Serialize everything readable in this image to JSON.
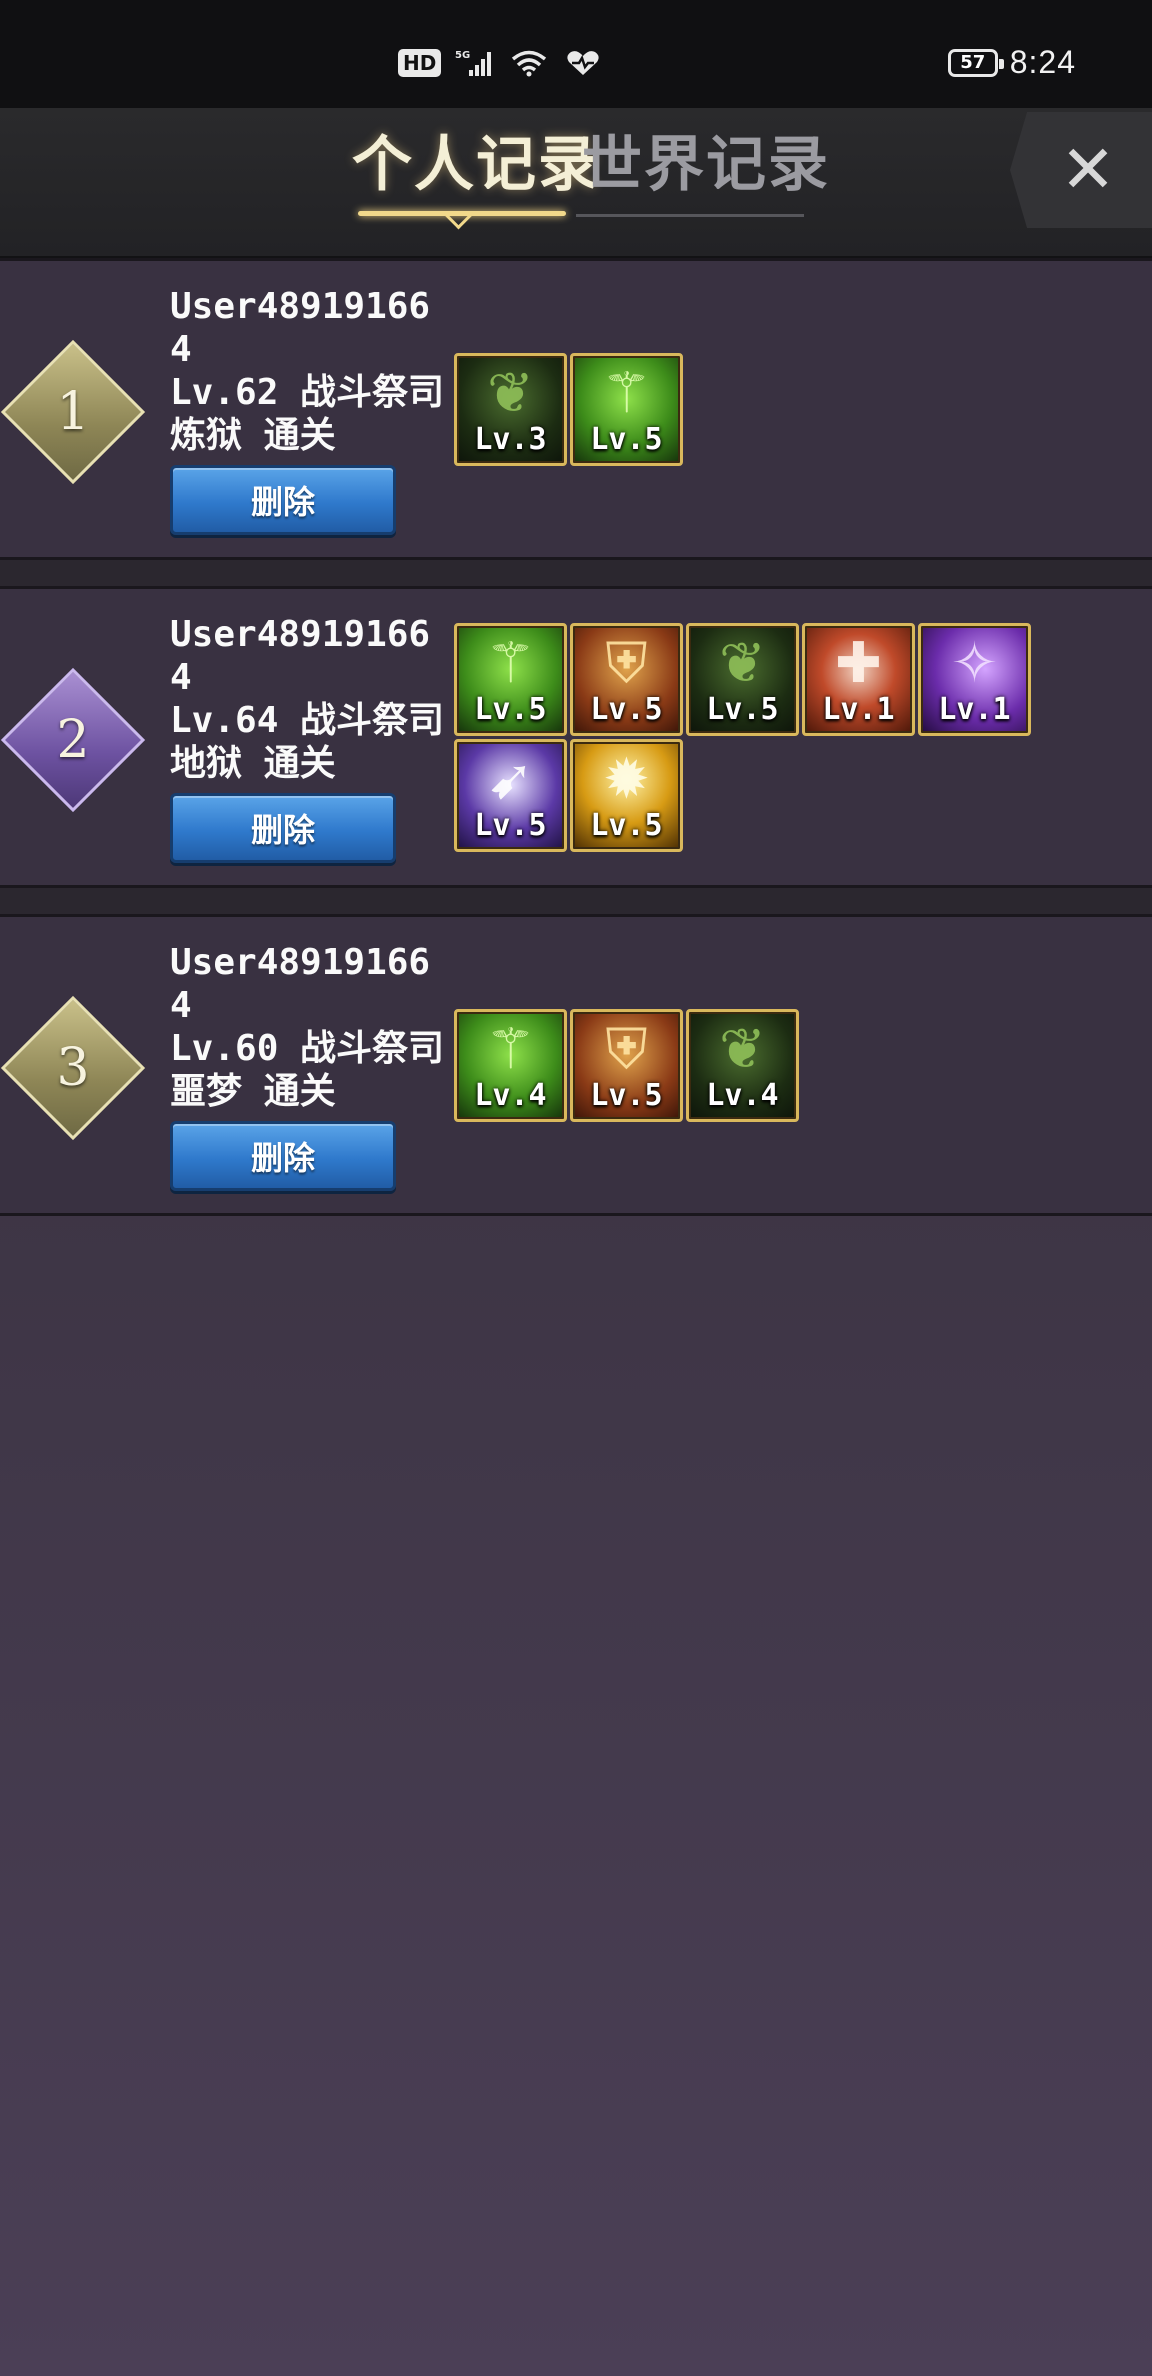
{
  "status_bar": {
    "hd": "HD",
    "network": "5G",
    "battery": "57",
    "time": "8:24"
  },
  "header": {
    "tabs": [
      {
        "label": "个人记录",
        "active": true
      },
      {
        "label": "世界记录",
        "active": false
      }
    ],
    "close": "✕"
  },
  "records": [
    {
      "rank": "1",
      "user": "User489191664",
      "level_class": "Lv.62 战斗祭司",
      "difficulty_result": "炼狱 通关",
      "delete_label": "删除",
      "skills": [
        {
          "icon": "vine-icon",
          "level": "Lv.3"
        },
        {
          "icon": "green-staff-icon",
          "level": "Lv.5"
        }
      ]
    },
    {
      "rank": "2",
      "user": "User489191664",
      "level_class": "Lv.64 战斗祭司",
      "difficulty_result": "地狱 通关",
      "delete_label": "删除",
      "skills": [
        {
          "icon": "green-staff-icon",
          "level": "Lv.5"
        },
        {
          "icon": "golden-shield-icon",
          "level": "Lv.5"
        },
        {
          "icon": "vine-icon",
          "level": "Lv.5"
        },
        {
          "icon": "holy-cross-icon",
          "level": "Lv.1"
        },
        {
          "icon": "purple-claw-icon",
          "level": "Lv.1"
        },
        {
          "icon": "violet-strike-icon",
          "level": "Lv.5"
        },
        {
          "icon": "holy-light-icon",
          "level": "Lv.5"
        }
      ]
    },
    {
      "rank": "3",
      "user": "User489191664",
      "level_class": "Lv.60 战斗祭司",
      "difficulty_result": "噩梦 通关",
      "delete_label": "删除",
      "skills": [
        {
          "icon": "green-staff-icon",
          "level": "Lv.4"
        },
        {
          "icon": "golden-shield-icon",
          "level": "Lv.5"
        },
        {
          "icon": "vine-icon",
          "level": "Lv.4"
        }
      ]
    }
  ]
}
